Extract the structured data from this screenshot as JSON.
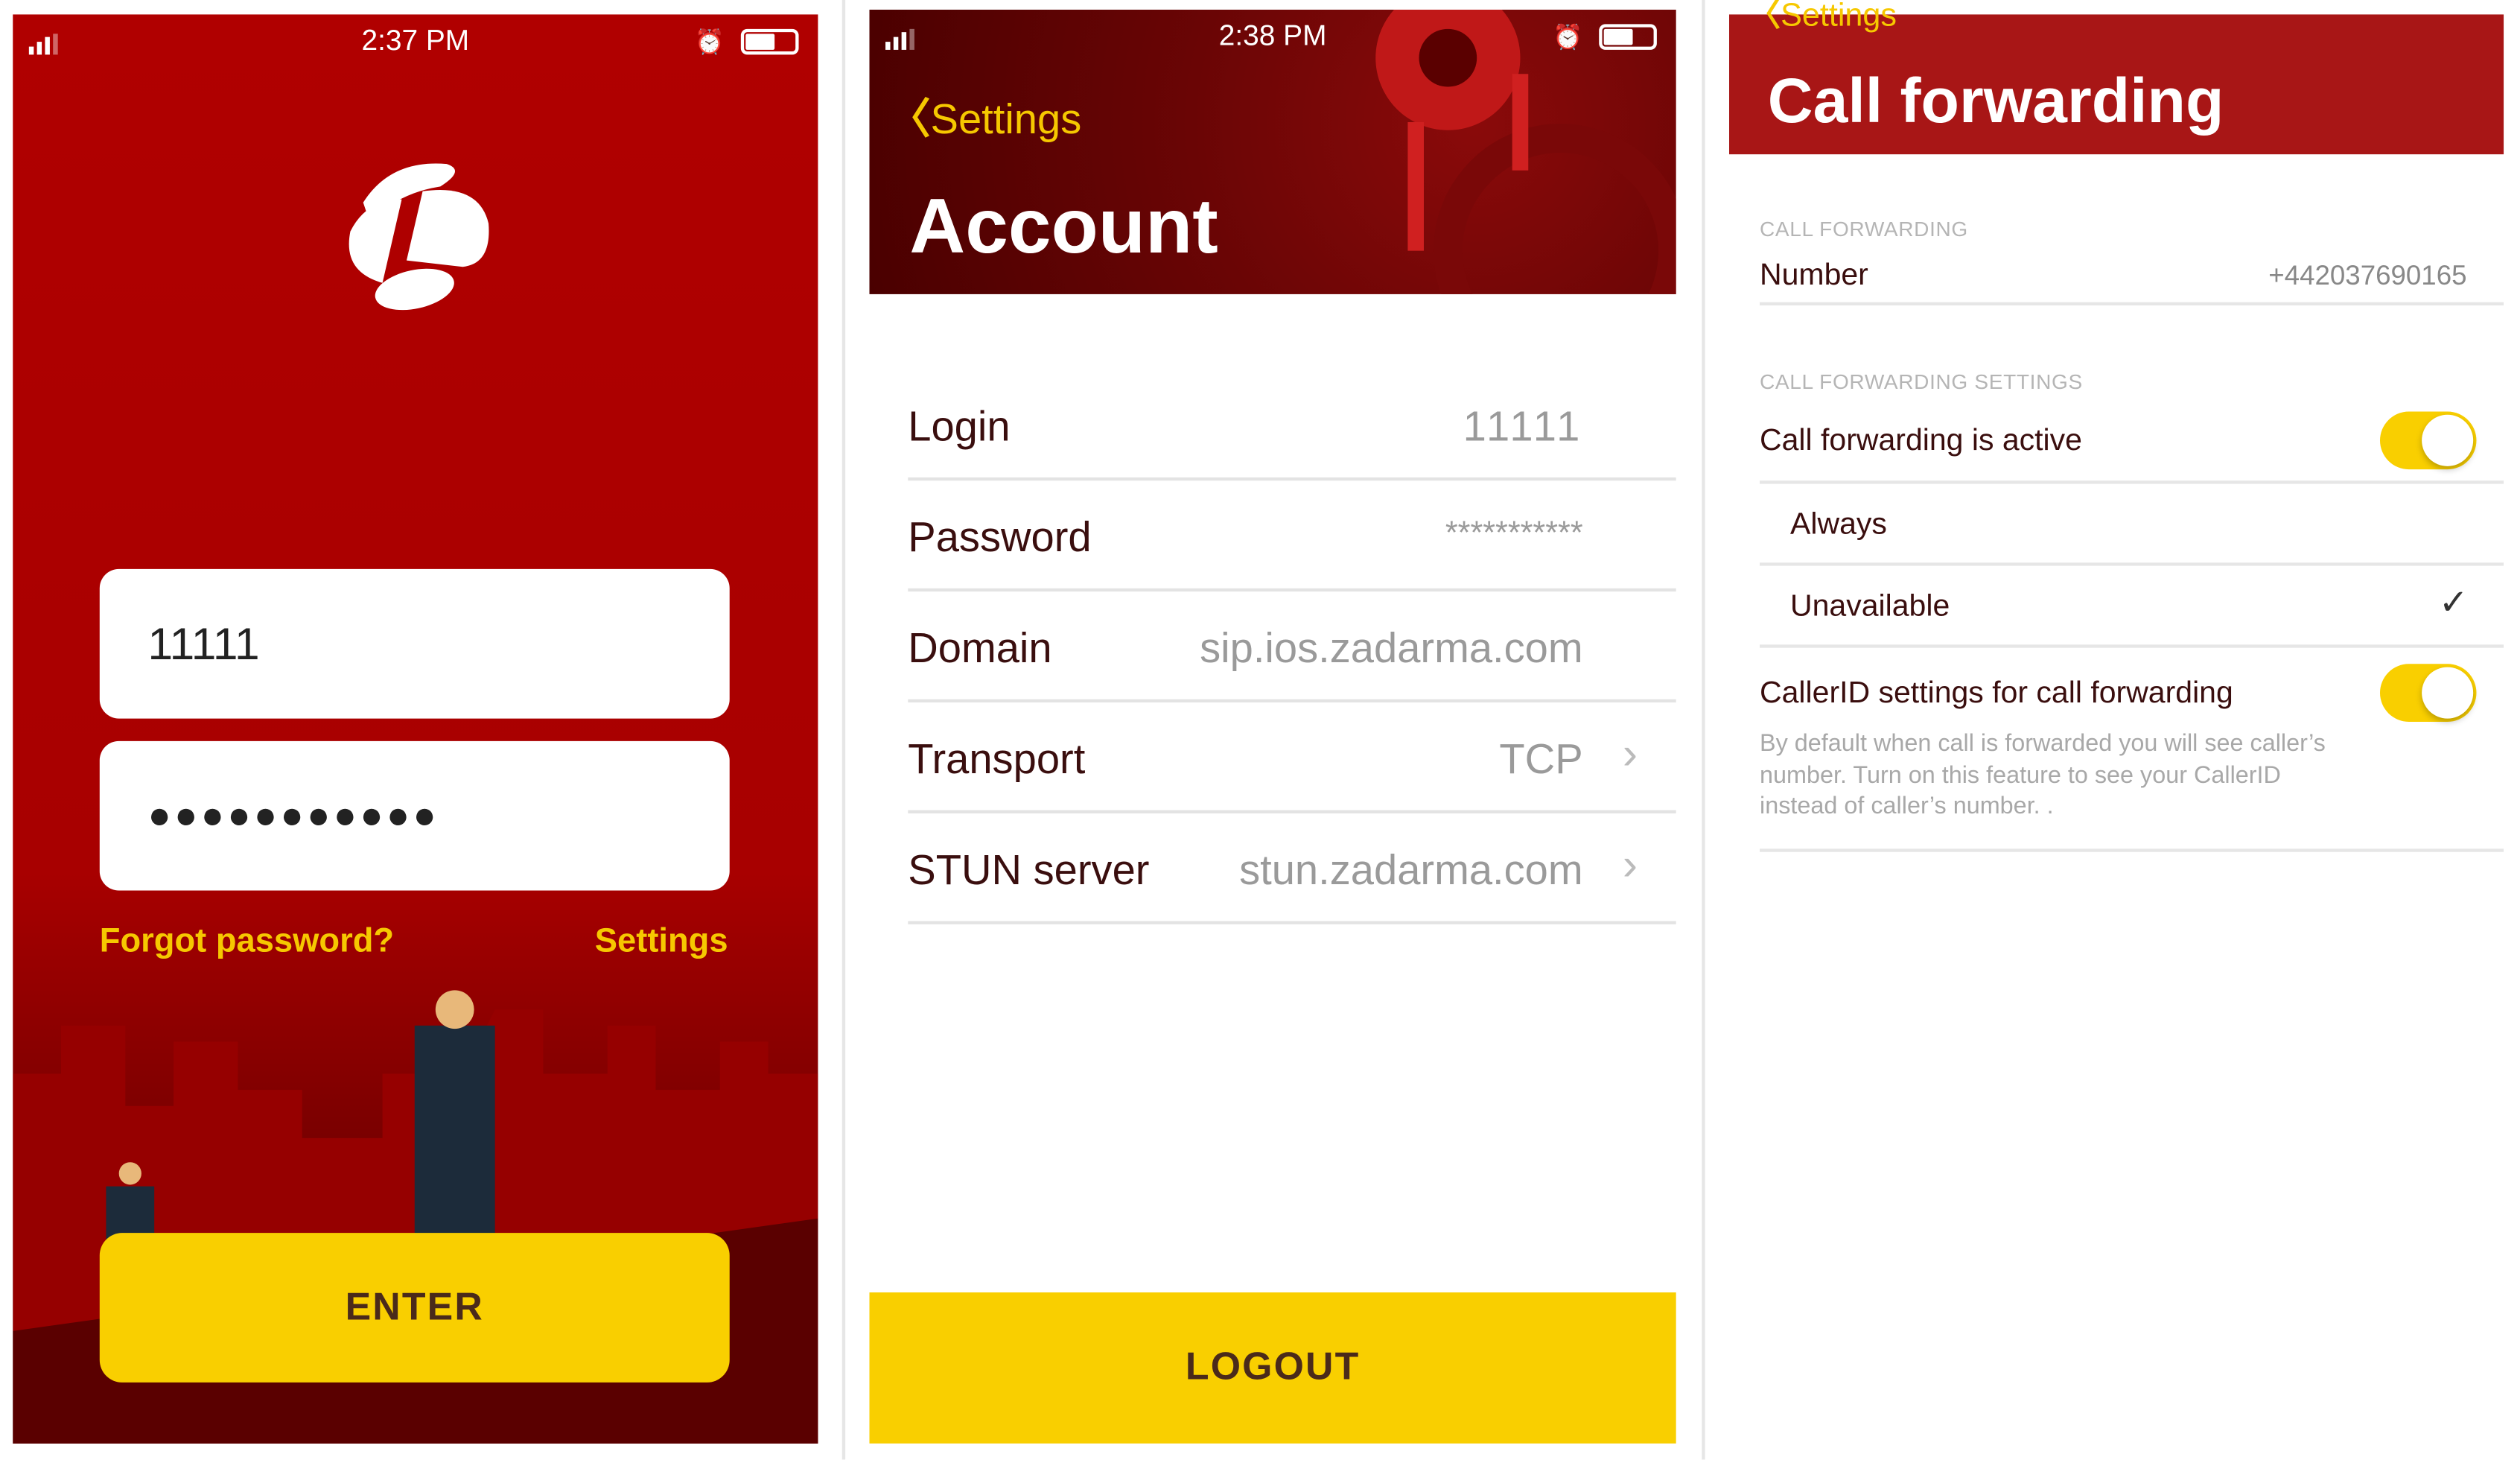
{
  "colors": {
    "brand_red": "#b00000",
    "accent_yellow": "#f9cf00",
    "text_dark": "#3a0e0e"
  },
  "login_screen": {
    "status": {
      "time": "2:37 PM"
    },
    "login_value": "11111",
    "password_value": "●●●●●●●●●●●",
    "forgot_password": "Forgot password?",
    "settings": "Settings",
    "enter": "ENTER"
  },
  "account_screen": {
    "status": {
      "time": "2:38 PM"
    },
    "back": "Settings",
    "title": "Account",
    "rows": [
      {
        "label": "Login",
        "value": "11111"
      },
      {
        "label": "Password",
        "value": "***********"
      },
      {
        "label": "Domain",
        "value": "sip.ios.zadarma.com"
      },
      {
        "label": "Transport",
        "value": "TCP"
      },
      {
        "label": "STUN server",
        "value": "stun.zadarma.com"
      }
    ],
    "logout": "LOGOUT"
  },
  "forwarding_screen": {
    "back": "Settings",
    "title": "Call forwarding",
    "section1": "CALL FORWARDING",
    "number_label": "Number",
    "number_value": "+442037690165",
    "section2": "CALL FORWARDING SETTINGS",
    "active_label": "Call forwarding is active",
    "active_on": true,
    "always": "Always",
    "unavailable": "Unavailable",
    "selected": "Unavailable",
    "callerid_label": "CallerID settings for call forwarding",
    "callerid_on": true,
    "callerid_note": "By default when call is forwarded you will see caller’s number. Turn on this feature to see your CallerID instead of caller’s number. ."
  }
}
